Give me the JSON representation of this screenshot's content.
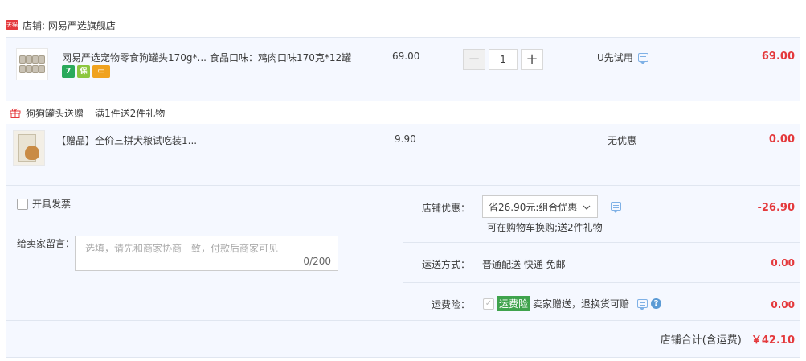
{
  "shop": {
    "logo_text": "天猫",
    "name": "店铺: 网易严选旗舰店"
  },
  "item1": {
    "title": "网易严选宠物零食狗罐头170g*...",
    "sku": "食品口味：鸡肉口味170克*12罐",
    "unit_price": "69.00",
    "quantity": "1",
    "minus": "−",
    "plus": "+",
    "promo": "U先试用",
    "subtotal": "69.00",
    "badges": [
      {
        "icon": "seven-day-return-icon",
        "text": "7",
        "color": "#2aaa5c"
      },
      {
        "icon": "guarantee-icon",
        "text": "保",
        "color": "#8cc63f"
      },
      {
        "icon": "card-icon",
        "text": "▭",
        "color": "#f0a21e"
      }
    ]
  },
  "gift_promo": {
    "label": "狗狗罐头送赠",
    "rule": "满1件送2件礼物"
  },
  "item2": {
    "title": "【赠品】全价三拼犬粮试吃装1...",
    "unit_price": "9.90",
    "promo": "无优惠",
    "subtotal": "0.00"
  },
  "invoice": {
    "label": "开具发票"
  },
  "message": {
    "label": "给卖家留言：",
    "placeholder": "选填，请先和商家协商一致，付款后商家可见",
    "counter": "0/200"
  },
  "discount": {
    "label": "店铺优惠：",
    "selected": "省26.90元:组合优惠",
    "note": "可在购物车换购;送2件礼物",
    "amount": "-26.90"
  },
  "shipping": {
    "label": "运送方式：",
    "value": "普通配送 快递 免邮",
    "amount": "0.00"
  },
  "insurance": {
    "label": "运费险：",
    "tag": "运费险",
    "desc": "卖家赠送，退换货可赔",
    "amount": "0.00"
  },
  "total": {
    "label": "店铺合计(含运费)",
    "value": "￥42.10"
  },
  "colors": {
    "accent_red": "#e4393c",
    "panel_bg": "#f5f8ff",
    "tag_green": "#3fa34d"
  }
}
